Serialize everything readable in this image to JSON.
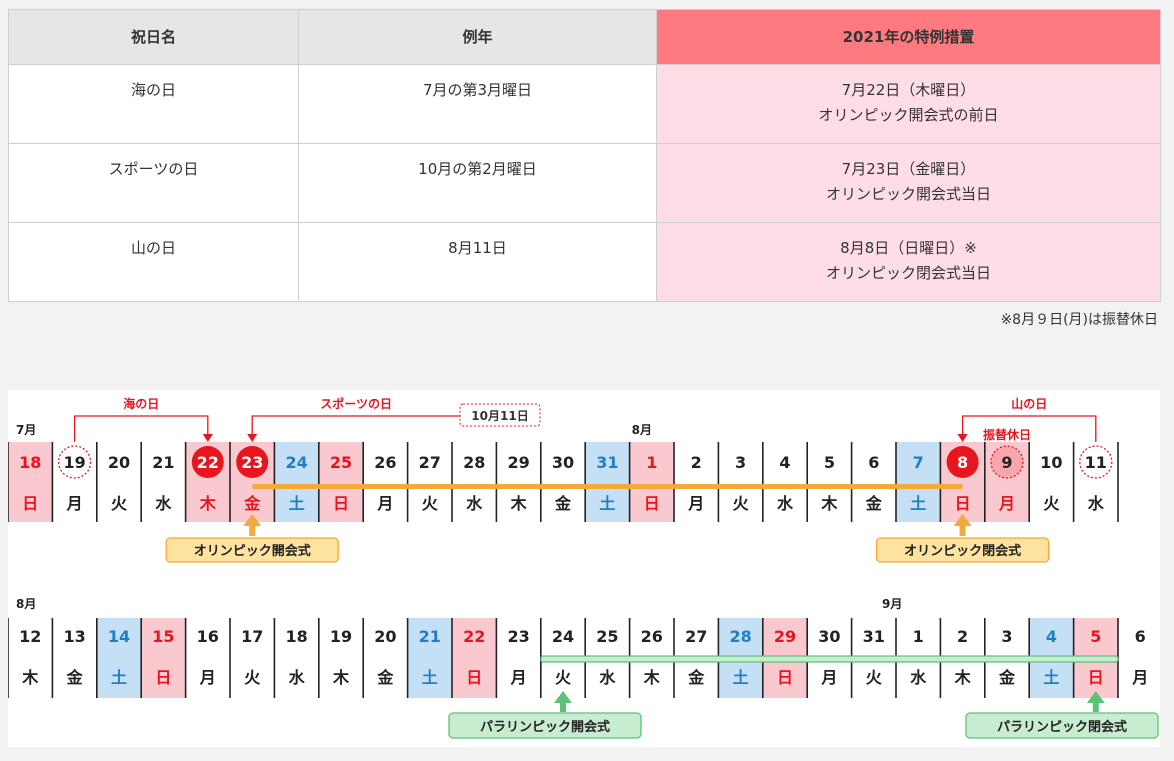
{
  "table": {
    "headers": [
      "祝日名",
      "例年",
      "2021年の特例措置"
    ],
    "rows": [
      {
        "name": "海の日",
        "usual": "7月の第3月曜日",
        "special1": "7月22日（木曜日）",
        "special2": "オリンピック開会式の前日"
      },
      {
        "name": "スポーツの日",
        "usual": "10月の第2月曜日",
        "special1": "7月23日（金曜日）",
        "special2": "オリンピック開会式当日"
      },
      {
        "name": "山の日",
        "usual": "8月11日",
        "special1": "8月8日（日曜日）※",
        "special2": "オリンピック閉会式当日"
      }
    ]
  },
  "note": "※8月９日(月)は振替休日",
  "colors": {
    "sun_red": "#e8141e",
    "sat_blue": "#1f7fc4",
    "sun_bg": "#f9c9cf",
    "sat_bg": "#c5e0f5",
    "olympic": "#f4a93b",
    "olympic_label_bg": "#fde2a0",
    "paralympic": "#5cc27a",
    "paralympic_label_bg": "#c8ecd0"
  },
  "calendar": {
    "row1": {
      "month_start": "7月",
      "month_mid": "8月",
      "month_mid_index": 14,
      "days": [
        {
          "n": "18",
          "d": "日",
          "t": "sun"
        },
        {
          "n": "19",
          "d": "月",
          "t": "wd",
          "mark": "dotted"
        },
        {
          "n": "20",
          "d": "火",
          "t": "wd"
        },
        {
          "n": "21",
          "d": "水",
          "t": "wd"
        },
        {
          "n": "22",
          "d": "木",
          "t": "hol",
          "mark": "circle"
        },
        {
          "n": "23",
          "d": "金",
          "t": "hol",
          "mark": "circle"
        },
        {
          "n": "24",
          "d": "土",
          "t": "sat"
        },
        {
          "n": "25",
          "d": "日",
          "t": "sun"
        },
        {
          "n": "26",
          "d": "月",
          "t": "wd"
        },
        {
          "n": "27",
          "d": "火",
          "t": "wd"
        },
        {
          "n": "28",
          "d": "水",
          "t": "wd"
        },
        {
          "n": "29",
          "d": "木",
          "t": "wd"
        },
        {
          "n": "30",
          "d": "金",
          "t": "wd"
        },
        {
          "n": "31",
          "d": "土",
          "t": "sat"
        },
        {
          "n": "1",
          "d": "日",
          "t": "sun"
        },
        {
          "n": "2",
          "d": "月",
          "t": "wd"
        },
        {
          "n": "3",
          "d": "火",
          "t": "wd"
        },
        {
          "n": "4",
          "d": "水",
          "t": "wd"
        },
        {
          "n": "5",
          "d": "木",
          "t": "wd"
        },
        {
          "n": "6",
          "d": "金",
          "t": "wd"
        },
        {
          "n": "7",
          "d": "土",
          "t": "sat"
        },
        {
          "n": "8",
          "d": "日",
          "t": "sun",
          "mark": "circle"
        },
        {
          "n": "9",
          "d": "月",
          "t": "sun",
          "mark": "pink"
        },
        {
          "n": "10",
          "d": "火",
          "t": "wd"
        },
        {
          "n": "11",
          "d": "水",
          "t": "wd",
          "mark": "dotted"
        }
      ],
      "umi_label": "海の日",
      "sports_label": "スポーツの日",
      "sports_orig": "10月11日",
      "yama_label": "山の日",
      "furikae_label": "振替休日",
      "open_label": "オリンピック開会式",
      "close_label": "オリンピック閉会式"
    },
    "row2": {
      "month_start": "8月",
      "month_mid": "9月",
      "month_mid_index": 20,
      "days": [
        {
          "n": "12",
          "d": "木",
          "t": "wd"
        },
        {
          "n": "13",
          "d": "金",
          "t": "wd"
        },
        {
          "n": "14",
          "d": "土",
          "t": "sat"
        },
        {
          "n": "15",
          "d": "日",
          "t": "sun"
        },
        {
          "n": "16",
          "d": "月",
          "t": "wd"
        },
        {
          "n": "17",
          "d": "火",
          "t": "wd"
        },
        {
          "n": "18",
          "d": "水",
          "t": "wd"
        },
        {
          "n": "19",
          "d": "木",
          "t": "wd"
        },
        {
          "n": "20",
          "d": "金",
          "t": "wd"
        },
        {
          "n": "21",
          "d": "土",
          "t": "sat"
        },
        {
          "n": "22",
          "d": "日",
          "t": "sun"
        },
        {
          "n": "23",
          "d": "月",
          "t": "wd"
        },
        {
          "n": "24",
          "d": "火",
          "t": "wd"
        },
        {
          "n": "25",
          "d": "水",
          "t": "wd"
        },
        {
          "n": "26",
          "d": "木",
          "t": "wd"
        },
        {
          "n": "27",
          "d": "金",
          "t": "wd"
        },
        {
          "n": "28",
          "d": "土",
          "t": "sat"
        },
        {
          "n": "29",
          "d": "日",
          "t": "sun"
        },
        {
          "n": "30",
          "d": "月",
          "t": "wd"
        },
        {
          "n": "31",
          "d": "火",
          "t": "wd"
        },
        {
          "n": "1",
          "d": "水",
          "t": "wd"
        },
        {
          "n": "2",
          "d": "木",
          "t": "wd"
        },
        {
          "n": "3",
          "d": "金",
          "t": "wd"
        },
        {
          "n": "4",
          "d": "土",
          "t": "sat"
        },
        {
          "n": "5",
          "d": "日",
          "t": "sun"
        },
        {
          "n": "6",
          "d": "月",
          "t": "wd"
        }
      ],
      "open_label": "パラリンピック開会式",
      "close_label": "パラリンピック閉会式"
    }
  }
}
